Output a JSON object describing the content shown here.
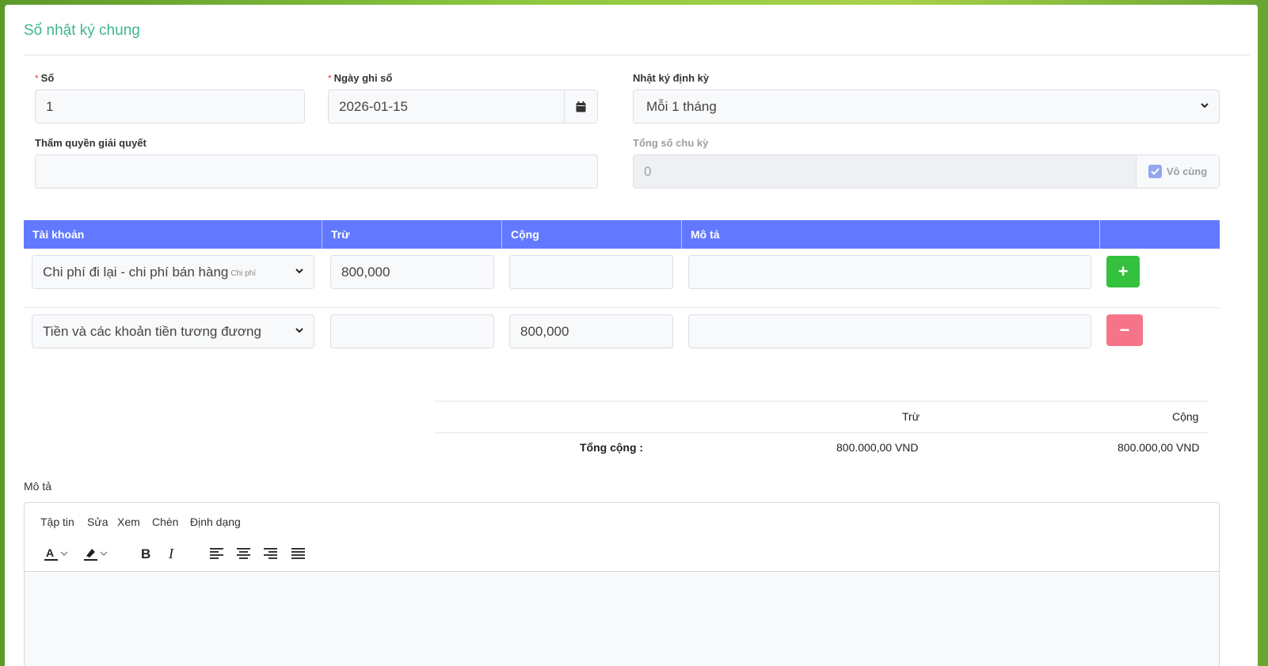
{
  "page": {
    "title": "Sổ nhật ký chung"
  },
  "form": {
    "so": {
      "label": "Số",
      "value": "1"
    },
    "ngay_ghi_so": {
      "label": "Ngày ghi sổ",
      "value": "2026-01-15"
    },
    "nhat_ky_dinh_ky": {
      "label": "Nhật ký định kỳ",
      "value": "Mỗi 1 tháng"
    },
    "tham_quyen": {
      "label": "Thẩm quyền giải quyết",
      "value": ""
    },
    "tong_so_chu_ky": {
      "label": "Tổng số chu kỳ",
      "value": "0",
      "checkbox_label": "Vô cùng",
      "checked": true
    }
  },
  "table": {
    "headers": [
      "Tài khoản",
      "Trừ",
      "Cộng",
      "Mô tả"
    ],
    "rows": [
      {
        "account": "Chi phí đi lại - chi phí bán hàng",
        "account_tag": "Chi phí",
        "debit": "800,000",
        "credit": "",
        "description": "",
        "action": "+"
      },
      {
        "account": "Tiền và các khoản tiền tương đương",
        "account_tag": "",
        "debit": "",
        "credit": "800,000",
        "description": "",
        "action": "−"
      }
    ]
  },
  "totals": {
    "debit_header": "Trừ",
    "credit_header": "Cộng",
    "label": "Tổng cộng :",
    "debit_total": "800.000,00 VND",
    "credit_total": "800.000,00 VND"
  },
  "description": {
    "label": "Mô tả",
    "menu": [
      "Tập tin",
      "Sửa",
      "Xem",
      "Chèn",
      "Định dạng"
    ],
    "toolbar_icons": [
      "text-color-icon",
      "highlight-icon",
      "bold-icon",
      "italic-icon",
      "align-left-icon",
      "align-center-icon",
      "align-right-icon",
      "align-justify-icon"
    ]
  },
  "colors": {
    "accent": "#3fb68b",
    "table_header": "#6279ff",
    "add_button": "#33c13e",
    "remove_button": "#f6748a"
  }
}
